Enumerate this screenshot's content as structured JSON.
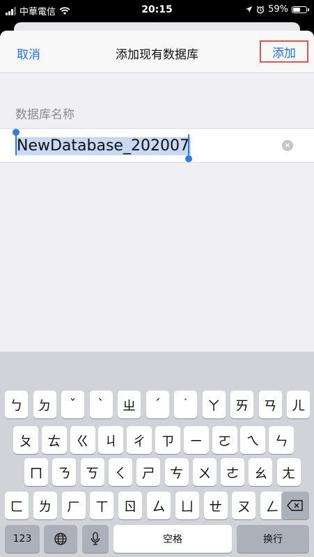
{
  "status_bar": {
    "carrier": "中華電信",
    "time": "20:15",
    "battery": "59%",
    "battery_level": 0.59
  },
  "nav": {
    "cancel": "取消",
    "title": "添加现有数据库",
    "add": "添加"
  },
  "form": {
    "section_label": "数据库名称",
    "name_value": "NewDatabase_202007",
    "clear_icon": "clear-x-icon"
  },
  "keyboard": {
    "row1": [
      "ㄅ",
      "ㄉ",
      "ˇ",
      "ˋ",
      "ㄓ",
      "ˊ",
      "˙",
      "ㄚ",
      "ㄞ",
      "ㄢ",
      "ㄦ"
    ],
    "row2": [
      "ㄆ",
      "ㄊ",
      "ㄍ",
      "ㄐ",
      "ㄔ",
      "ㄗ",
      "ㄧ",
      "ㄛ",
      "ㄟ",
      "ㄣ"
    ],
    "row3": [
      "ㄇ",
      "ㄋ",
      "ㄎ",
      "ㄑ",
      "ㄕ",
      "ㄘ",
      "ㄨ",
      "ㄜ",
      "ㄠ",
      "ㄤ"
    ],
    "row4": [
      "ㄈ",
      "ㄌ",
      "ㄏ",
      "ㄒ",
      "ㄖ",
      "ㄙ",
      "ㄩ",
      "ㄝ",
      "ㄡ",
      "ㄥ"
    ],
    "numbers": "123",
    "globe_icon": "globe-icon",
    "mic_icon": "microphone-icon",
    "space": "空格",
    "return": "换行",
    "delete_icon": "backspace-icon"
  }
}
